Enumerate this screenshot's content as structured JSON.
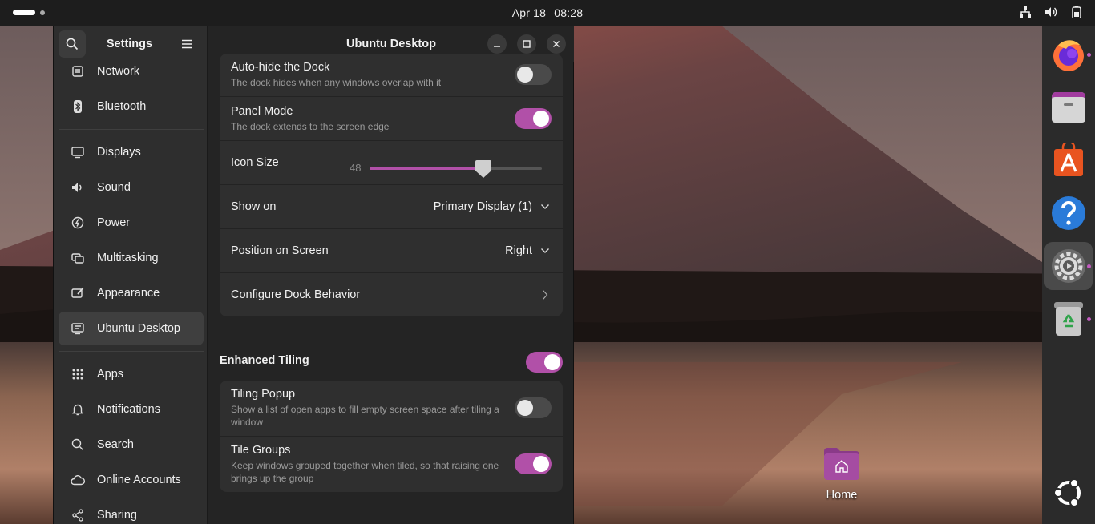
{
  "topbar": {
    "date": "Apr 18",
    "time": "08:28",
    "tray_icons": [
      "network-icon",
      "volume-icon",
      "battery-icon"
    ]
  },
  "dock": {
    "apps": [
      {
        "name": "firefox",
        "running": true
      },
      {
        "name": "files",
        "running": false
      },
      {
        "name": "app-center",
        "running": false
      },
      {
        "name": "help",
        "running": false
      },
      {
        "name": "settings",
        "running": true,
        "active": true
      },
      {
        "name": "trash",
        "running": true
      }
    ],
    "show_apps": "show-apps"
  },
  "desktop": {
    "home_label": "Home"
  },
  "sidebar": {
    "title": "Settings",
    "items": [
      {
        "label": "Network",
        "icon": "network-icon"
      },
      {
        "label": "Bluetooth",
        "icon": "bluetooth-icon"
      },
      {
        "label": "Displays",
        "icon": "display-icon"
      },
      {
        "label": "Sound",
        "icon": "sound-icon"
      },
      {
        "label": "Power",
        "icon": "power-icon"
      },
      {
        "label": "Multitasking",
        "icon": "multitasking-icon"
      },
      {
        "label": "Appearance",
        "icon": "appearance-icon"
      },
      {
        "label": "Ubuntu Desktop",
        "icon": "ubuntu-desktop-icon",
        "selected": true
      },
      {
        "label": "Apps",
        "icon": "apps-icon"
      },
      {
        "label": "Notifications",
        "icon": "bell-icon"
      },
      {
        "label": "Search",
        "icon": "search-icon"
      },
      {
        "label": "Online Accounts",
        "icon": "cloud-icon"
      },
      {
        "label": "Sharing",
        "icon": "share-icon"
      }
    ]
  },
  "content": {
    "title": "Ubuntu Desktop",
    "dock_settings": {
      "autohide": {
        "title": "Auto-hide the Dock",
        "subtitle": "The dock hides when any windows overlap with it",
        "enabled": false
      },
      "panel_mode": {
        "title": "Panel Mode",
        "subtitle": "The dock extends to the screen edge",
        "enabled": true
      },
      "icon_size": {
        "title": "Icon Size",
        "value": "48",
        "fraction": 0.66
      },
      "show_on": {
        "title": "Show on",
        "value": "Primary Display (1)"
      },
      "position": {
        "title": "Position on Screen",
        "value": "Right"
      },
      "configure": {
        "title": "Configure Dock Behavior"
      }
    },
    "tiling": {
      "title": "Enhanced Tiling",
      "enabled": true,
      "popup": {
        "title": "Tiling Popup",
        "subtitle": "Show a list of open apps to fill empty screen space after tiling a window",
        "enabled": false
      },
      "groups": {
        "title": "Tile Groups",
        "subtitle": "Keep windows grouped together when tiled, so that raising one brings up the group",
        "enabled": true
      }
    }
  },
  "colors": {
    "accent": "#b150a8",
    "sidebar_bg": "#2e2e2e",
    "content_bg": "#242424",
    "card_bg": "#2f2f2f"
  }
}
